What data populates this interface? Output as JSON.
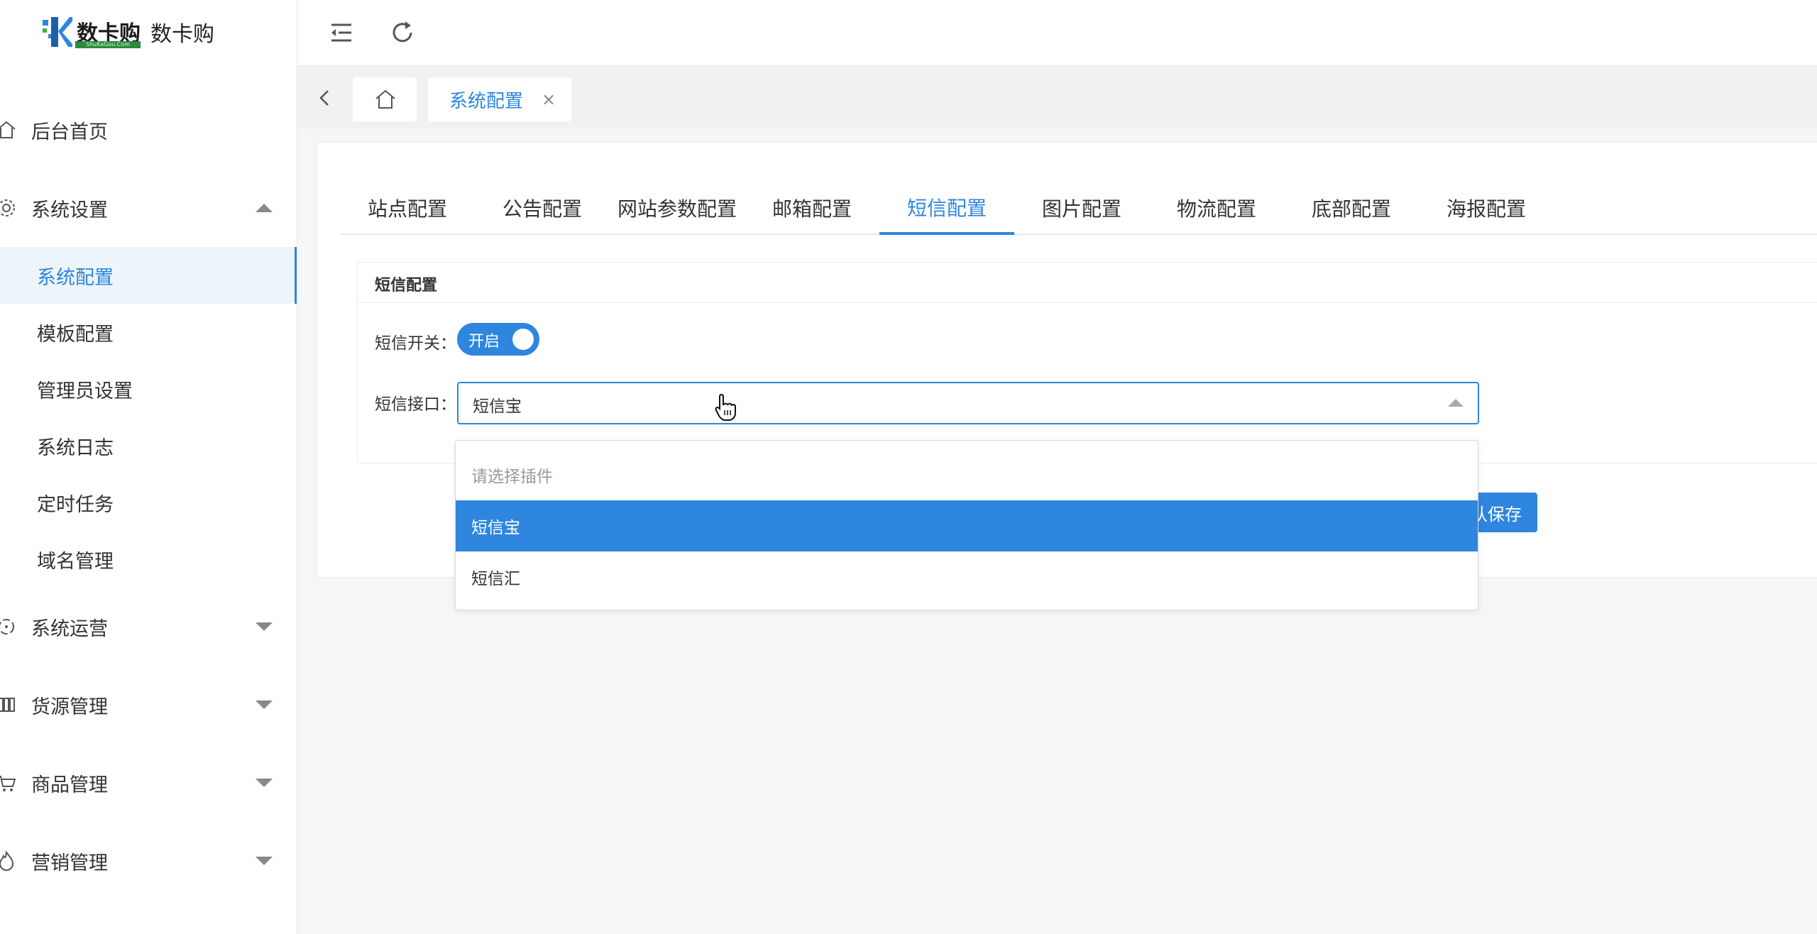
{
  "brand": {
    "logo_word": "数卡购",
    "logo_sub": "ShuKaGou.Com",
    "name": "数卡购"
  },
  "sidebar": {
    "items": [
      {
        "label": "后台首页",
        "icon": "home-icon"
      },
      {
        "label": "系统设置",
        "icon": "gear-icon",
        "expanded": true,
        "children": [
          "系统配置",
          "模板配置",
          "管理员设置",
          "系统日志",
          "定时任务",
          "域名管理"
        ],
        "active_child": "系统配置"
      },
      {
        "label": "系统运营",
        "icon": "operations-icon"
      },
      {
        "label": "货源管理",
        "icon": "supply-icon"
      },
      {
        "label": "商品管理",
        "icon": "cart-icon"
      },
      {
        "label": "营销管理",
        "icon": "fire-icon"
      }
    ]
  },
  "topbar": {
    "icons": [
      "menu-fold-icon",
      "refresh-icon"
    ]
  },
  "tabs": {
    "active_label": "系统配置",
    "close_glyph": "×"
  },
  "config_tabs": [
    "站点配置",
    "公告配置",
    "网站参数配置",
    "邮箱配置",
    "短信配置",
    "图片配置",
    "物流配置",
    "底部配置",
    "海报配置"
  ],
  "config_tab_active": "短信配置",
  "panel": {
    "title": "短信配置",
    "switch_label": "短信开关：",
    "switch_text": "开启",
    "interface_label": "短信接口：",
    "interface_value": "短信宝"
  },
  "dropdown": {
    "placeholder": "请选择插件",
    "options": [
      "短信宝",
      "短信汇"
    ],
    "selected": "短信宝"
  },
  "save_button": {
    "label_visible": "认保存"
  },
  "colors": {
    "accent": "#2e86de",
    "background": "#f5f6f8"
  }
}
